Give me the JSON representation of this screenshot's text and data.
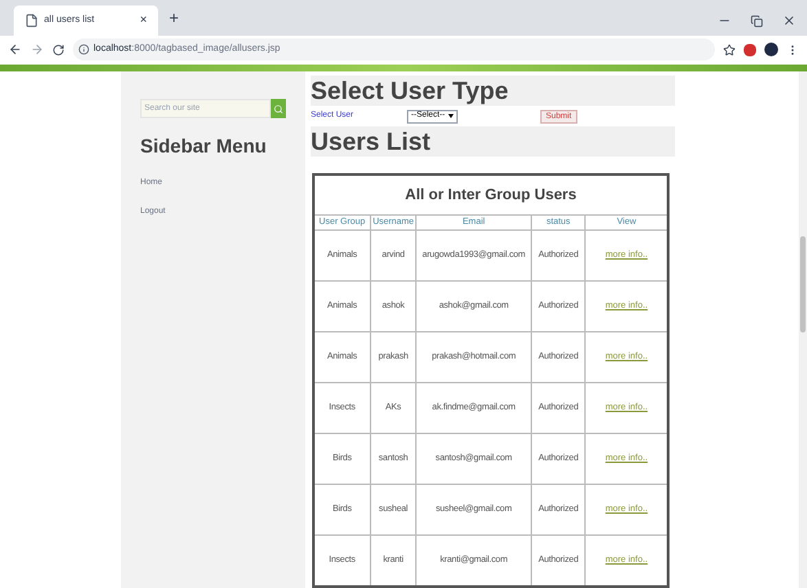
{
  "browser": {
    "tab_title": "all users list",
    "tab_close": "×",
    "new_tab": "+",
    "url_host": "localhost",
    "url_path": ":8000/tagbased_image/allusers.jsp"
  },
  "sidebar": {
    "search": {
      "placeholder": "Search our site"
    },
    "title": "Sidebar Menu",
    "items": [
      {
        "label": "Home"
      },
      {
        "label": "Logout"
      }
    ]
  },
  "select_section": {
    "title": "Select User Type",
    "label": "Select User",
    "dropdown": "--Select--",
    "button": "Submit"
  },
  "users_section": {
    "title": "Users List"
  },
  "table": {
    "caption": "All or Inter Group Users",
    "columns": [
      "User Group",
      "Username",
      "Email",
      "status",
      "View"
    ],
    "rows": [
      {
        "group": "Animals",
        "username": "arvind",
        "email": "arugowda1993@gmail.com",
        "status": "Authorized",
        "view": "more info.."
      },
      {
        "group": "Animals",
        "username": "ashok",
        "email": "ashok@gmail.com",
        "status": "Authorized",
        "view": "more info.."
      },
      {
        "group": "Animals",
        "username": "prakash",
        "email": "prakash@hotmail.com",
        "status": "Authorized",
        "view": "more info.."
      },
      {
        "group": "Insects",
        "username": "AKs",
        "email": "ak.findme@gmail.com",
        "status": "Authorized",
        "view": "more info.."
      },
      {
        "group": "Birds",
        "username": "santosh",
        "email": "santosh@gmail.com",
        "status": "Authorized",
        "view": "more info.."
      },
      {
        "group": "Birds",
        "username": "susheal",
        "email": "susheel@gmail.com",
        "status": "Authorized",
        "view": "more info.."
      },
      {
        "group": "Insects",
        "username": "kranti",
        "email": "kranti@gmail.com",
        "status": "Authorized",
        "view": "more info.."
      }
    ]
  }
}
